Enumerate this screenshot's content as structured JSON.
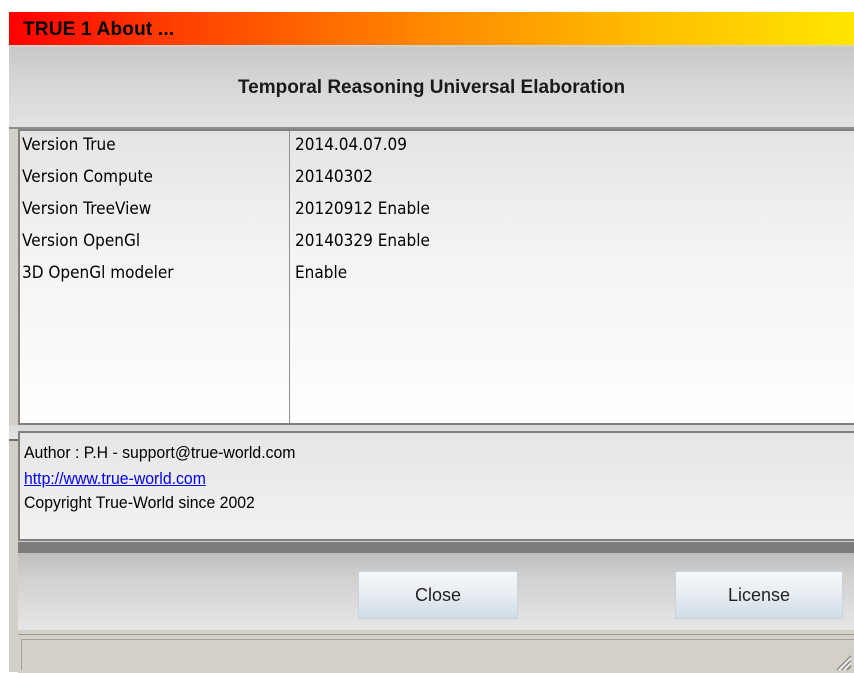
{
  "window": {
    "title": "TRUE 1 About ..."
  },
  "header": {
    "title": "Temporal Reasoning Universal Elaboration"
  },
  "versions": [
    {
      "label": "Version True",
      "value": "2014.04.07.09"
    },
    {
      "label": "Version Compute",
      "value": "20140302"
    },
    {
      "label": "Version TreeView",
      "value": "20120912 Enable"
    },
    {
      "label": "Version OpenGl",
      "value": "20140329 Enable"
    },
    {
      "label": "3D OpenGl modeler",
      "value": "Enable"
    }
  ],
  "info": {
    "author": "Author : P.H - support@true-world.com",
    "url": "http://www.true-world.com",
    "copyright": "Copyright True-World since 2002"
  },
  "buttons": {
    "close": "Close",
    "license": "License"
  },
  "icons": {
    "resize_grip": "resize-grip-icon"
  },
  "colors": {
    "title_gradient_start": "#ff0000",
    "title_gradient_end": "#ffe600",
    "link": "#0000ff"
  }
}
